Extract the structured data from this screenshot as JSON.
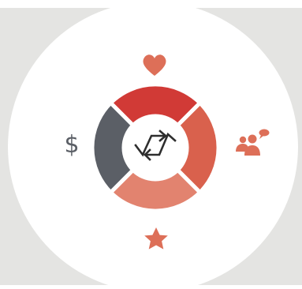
{
  "colors": {
    "background_gray": "#e4e4e2",
    "circle_white": "#ffffff",
    "segment_top": "#d13a36",
    "segment_right": "#d9614d",
    "segment_bottom": "#e2836f",
    "segment_left": "#5b5f66",
    "icon_accent": "#dd6f58",
    "icon_gray": "#5b5f66",
    "center_glyph": "#2e2e2e"
  },
  "icons": {
    "top": "heart-icon",
    "right": "people-chat-icon",
    "bottom": "star-icon",
    "left": "dollar-icon",
    "center": "sync-arrows-icon"
  },
  "labels": {
    "left_symbol": "$"
  }
}
